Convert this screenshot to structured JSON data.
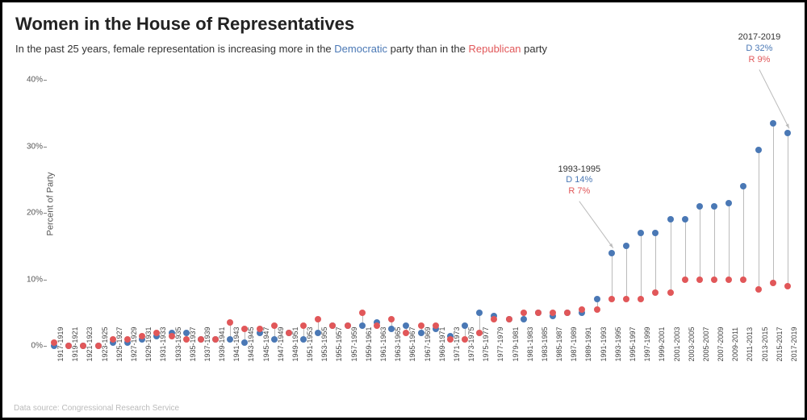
{
  "title": "Women in the House of Representatives",
  "subtitle_pre": "In the past 25 years, female representation is increasing more in the ",
  "subtitle_dem": "Democratic",
  "subtitle_mid": " party than in the ",
  "subtitle_rep": "Republican",
  "subtitle_post": " party",
  "ylabel": "Percent of Party",
  "footer": "Data source: Congressional Research Service",
  "annotations": {
    "a1": {
      "period": "1993-1995",
      "d": "D 14%",
      "r": "R 7%"
    },
    "a2": {
      "period": "2017-2019",
      "d": "D 32%",
      "r": "R 9%"
    }
  },
  "chart_data": {
    "type": "line",
    "xlabel": "",
    "ylabel": "Percent of Party",
    "ylim": [
      0,
      42
    ],
    "y_ticks": [
      0,
      10,
      20,
      30,
      40
    ],
    "categories": [
      "1917-1919",
      "1919-1921",
      "1921-1923",
      "1923-1925",
      "1925-1927",
      "1927-1929",
      "1929-1931",
      "1931-1933",
      "1933-1935",
      "1935-1937",
      "1937-1939",
      "1939-1941",
      "1941-1943",
      "1943-1945",
      "1945-1947",
      "1947-1949",
      "1949-1951",
      "1951-1953",
      "1953-1955",
      "1955-1957",
      "1957-1959",
      "1959-1961",
      "1961-1963",
      "1963-1965",
      "1965-1967",
      "1967-1969",
      "1969-1971",
      "1971-1973",
      "1973-1975",
      "1975-1977",
      "1977-1979",
      "1979-1981",
      "1981-1983",
      "1983-1985",
      "1985-1987",
      "1987-1989",
      "1989-1991",
      "1991-1993",
      "1993-1995",
      "1995-1997",
      "1997-1999",
      "1999-2001",
      "2001-2003",
      "2003-2005",
      "2005-2007",
      "2007-2009",
      "2009-2011",
      "2011-2013",
      "2013-2015",
      "2015-2017",
      "2017-2019"
    ],
    "series": [
      {
        "name": "Democratic",
        "color": "#4a78b5",
        "values": [
          0,
          0,
          0,
          0,
          0.5,
          0.5,
          1,
          1.5,
          2,
          2,
          1,
          1,
          1,
          0.5,
          2,
          1,
          2,
          1,
          2,
          3,
          3,
          3,
          3.5,
          2.5,
          3,
          2,
          2.5,
          1.5,
          3,
          5,
          4.5,
          4,
          4,
          5,
          4.5,
          5,
          5,
          7,
          14,
          15,
          17,
          17,
          19,
          19,
          21,
          21,
          21.5,
          24,
          29.5,
          33.5,
          32
        ]
      },
      {
        "name": "Republican",
        "color": "#e15759",
        "values": [
          0.5,
          0,
          0,
          0,
          1,
          1,
          1.5,
          2,
          1.5,
          1,
          1,
          1,
          3.5,
          2.5,
          2.5,
          3,
          2,
          3,
          4,
          3,
          3,
          5,
          3,
          4,
          2,
          3,
          3,
          1,
          1,
          2,
          4,
          4,
          5,
          5,
          5,
          5,
          5.5,
          5.5,
          7,
          7,
          7,
          8,
          8,
          10,
          10,
          10,
          10,
          10,
          8.5,
          9.5,
          9
        ]
      }
    ],
    "annotations": [
      {
        "category": "1993-1995",
        "text": "1993-1995 D 14% R 7%"
      },
      {
        "category": "2017-2019",
        "text": "2017-2019 D 32% R 9%"
      }
    ]
  }
}
